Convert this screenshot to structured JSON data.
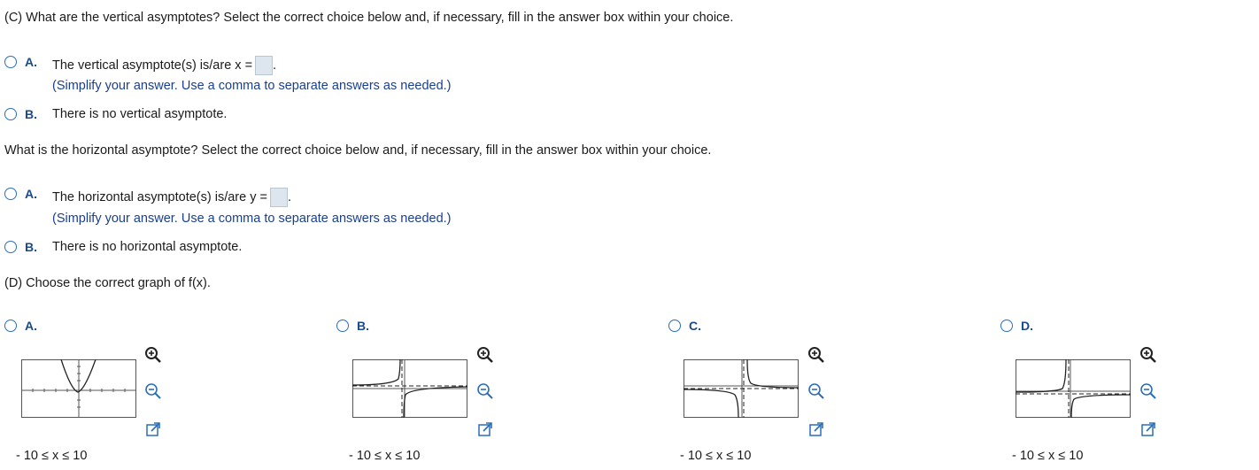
{
  "part_c": {
    "vertical_question": "(C) What are the vertical asymptotes? Select the correct choice below and, if necessary, fill in the answer box within your choice.",
    "vertical_options": [
      {
        "letter": "A.",
        "text": "The vertical asymptote(s) is/are x =",
        "hint": "(Simplify your answer. Use a comma to separate answers as needed.)"
      },
      {
        "letter": "B.",
        "text": "There is no vertical asymptote."
      }
    ],
    "horizontal_question": "What is the horizontal asymptote? Select the correct choice below and, if necessary, fill in the answer box within your choice.",
    "horizontal_options": [
      {
        "letter": "A.",
        "text": "The horizontal asymptote(s) is/are y =",
        "hint": "(Simplify your answer. Use a comma to separate answers as needed.)"
      },
      {
        "letter": "B.",
        "text": "There is no horizontal asymptote."
      }
    ]
  },
  "part_d": {
    "question": "(D) Choose the correct graph of f(x).",
    "graphs": [
      {
        "letter": "A.",
        "range": "- 10 ≤ x ≤ 10"
      },
      {
        "letter": "B.",
        "range": "- 10 ≤ x ≤ 10"
      },
      {
        "letter": "C.",
        "range": "- 10 ≤ x ≤ 10"
      },
      {
        "letter": "D.",
        "range": "- 10 ≤ x ≤ 10"
      }
    ]
  },
  "icons": [
    "zoom-in-icon",
    "zoom-out-icon",
    "enlarge-icon"
  ],
  "colors": {
    "accent": "#2a6ebb",
    "hint_text": "#1a3f8f",
    "answer_box": "#dde5ee"
  }
}
